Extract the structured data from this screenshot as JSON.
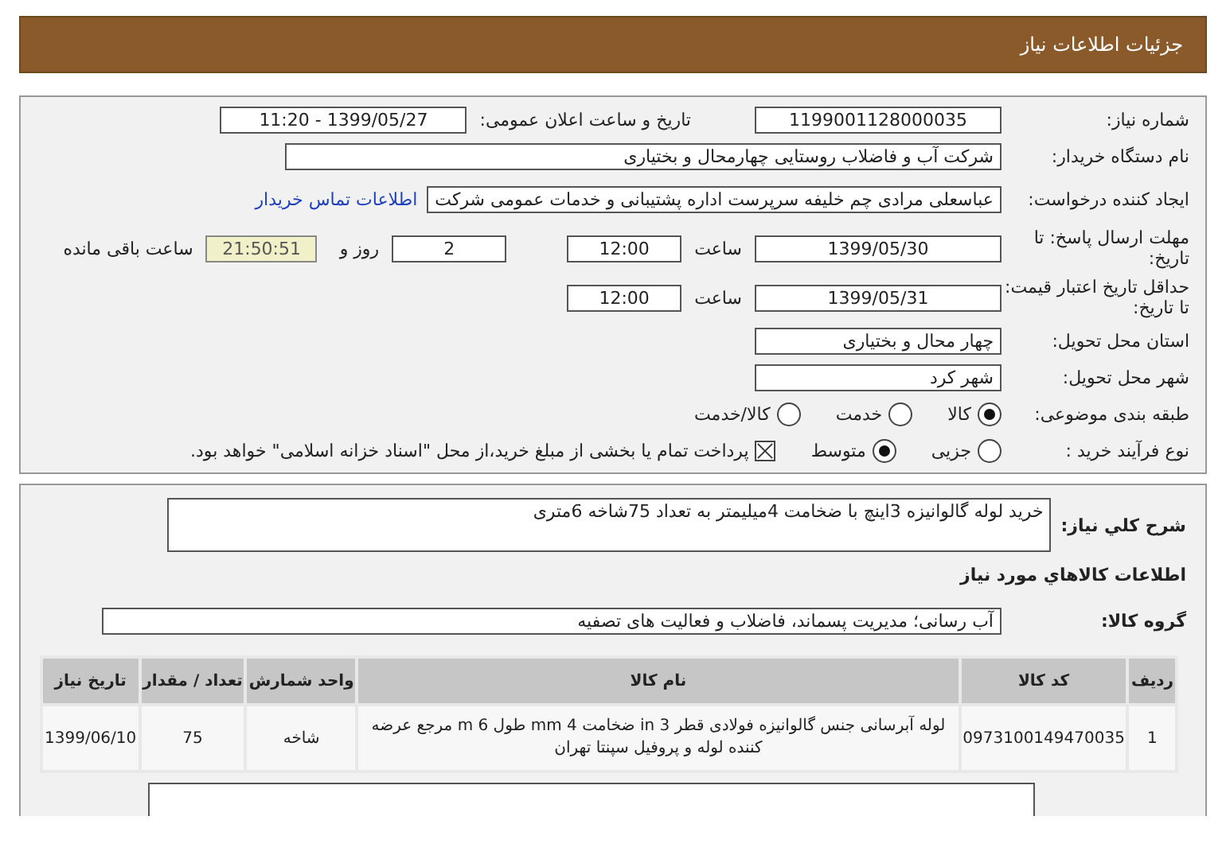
{
  "header": {
    "title": "جزئیات اطلاعات نیاز"
  },
  "need_number": {
    "label": "شماره نیاز:",
    "value": "1199001128000035"
  },
  "announce": {
    "label": "تاریخ و ساعت اعلان عمومی:",
    "value": "1399/05/27 - 11:20"
  },
  "buyer": {
    "label": "نام دستگاه خریدار:",
    "value": "شرکت آب و فاضلاب روستایی چهارمحال و بختیاری"
  },
  "requester": {
    "label": "ایجاد کننده درخواست:",
    "value": "عباسعلی مرادی چم خلیفه سرپرست اداره پشتیبانی و خدمات عمومی شرکت",
    "link": "اطلاعات تماس خریدار"
  },
  "reply_deadline": {
    "label": "مهلت ارسال پاسخ: تا تاریخ:",
    "date": "1399/05/30",
    "time_label": "ساعت",
    "time": "12:00",
    "days": "2",
    "days_label": "روز و",
    "remaining": "21:50:51",
    "remaining_label": "ساعت باقی مانده"
  },
  "price_validity": {
    "label": "حداقل تاریخ اعتبار قیمت: تا تاریخ:",
    "date": "1399/05/31",
    "time_label": "ساعت",
    "time": "12:00"
  },
  "province": {
    "label": "استان محل تحویل:",
    "value": "چهار محال و بختیاری"
  },
  "city": {
    "label": "شهر محل تحویل:",
    "value": "شهر کرد"
  },
  "category": {
    "label": "طبقه بندی موضوعی:",
    "options": [
      {
        "label": "کالا",
        "selected": true
      },
      {
        "label": "خدمت",
        "selected": false
      },
      {
        "label": "کالا/خدمت",
        "selected": false
      }
    ]
  },
  "process": {
    "label": "نوع فرآیند خرید :",
    "options": [
      {
        "label": "جزیی",
        "selected": false
      },
      {
        "label": "متوسط",
        "selected": true
      }
    ],
    "treasury": {
      "checked": true,
      "label": "پرداخت تمام یا بخشی از مبلغ خرید،از محل \"اسناد خزانه اسلامی\" خواهد بود."
    }
  },
  "description": {
    "label": "شرح کلي نياز:",
    "value": "خرید لوله گالوانیزه 3اینچ با ضخامت 4میلیمتر به تعداد 75شاخه 6متری"
  },
  "goods_heading": "اطلاعات کالاهاي مورد نياز",
  "goods_group": {
    "label": "گروه کالا:",
    "value": "آب رسانی؛ مدیریت پسماند، فاضلاب و فعالیت های تصفیه"
  },
  "table": {
    "columns": [
      "ردیف",
      "کد کالا",
      "نام کالا",
      "واحد شمارش",
      "تعداد / مقدار",
      "تاریخ نیاز"
    ],
    "rows": [
      [
        "1",
        "0973100149470035",
        "لوله آبرسانی جنس گالوانیزه فولادی قطر 3 in ضخامت 4 mm طول 6 m مرجع عرضه کننده لوله و پروفیل سپنتا تهران",
        "شاخه",
        "75",
        "1399/06/10"
      ]
    ]
  }
}
